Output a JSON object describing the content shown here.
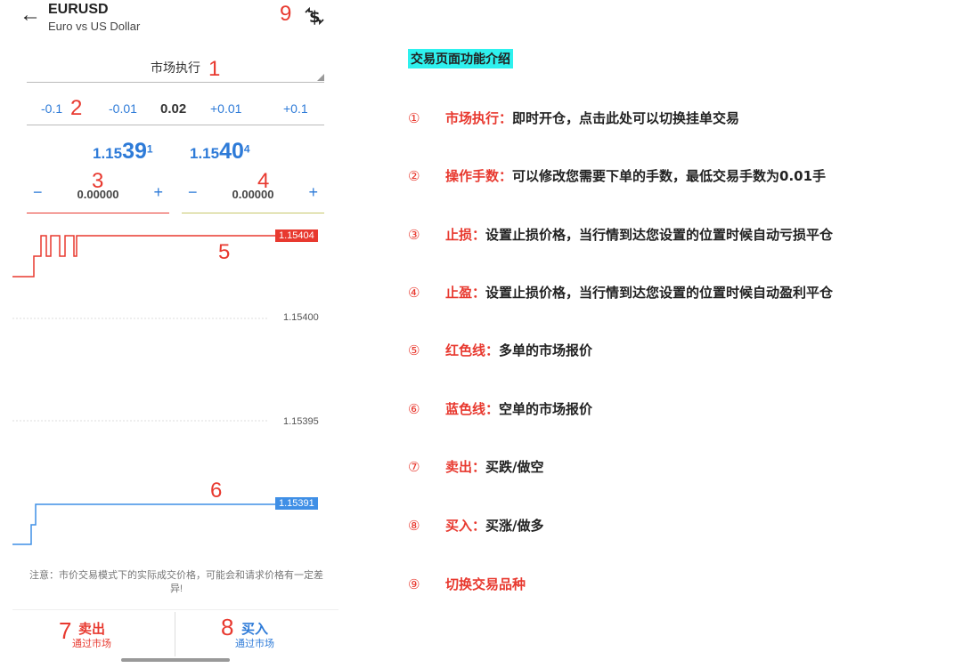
{
  "header": {
    "symbol": "EURUSD",
    "description": "Euro vs US Dollar",
    "switch_marker": "9"
  },
  "mode": {
    "label": "市场执行",
    "marker": "1"
  },
  "volume": {
    "marker": "2",
    "buttons": [
      "-0.1",
      "-0.01",
      "+0.01",
      "+0.1"
    ],
    "value": "0.02"
  },
  "prices": {
    "bid": {
      "prefix": "1.15",
      "big": "39",
      "sup": "1"
    },
    "ask": {
      "prefix": "1.15",
      "big": "40",
      "sup": "4"
    }
  },
  "stop_loss": {
    "marker": "3",
    "minus": "−",
    "plus": "+",
    "value": "0.00000",
    "color": "#e8392f"
  },
  "take_profit": {
    "marker": "4",
    "minus": "−",
    "plus": "+",
    "value": "0.00000",
    "color": "#c7c76b"
  },
  "chart": {
    "ask_tag": "1.15404",
    "bid_tag": "1.15391",
    "axis_labels": [
      "1.15400",
      "1.15395"
    ],
    "ask_marker": "5",
    "bid_marker": "6",
    "ask_color": "#e8392f",
    "bid_color": "#3f8fe6"
  },
  "notice": "注意：市价交易模式下的实际成交价格，可能会和请求价格有一定差异!",
  "sell": {
    "marker": "7",
    "label": "卖出",
    "sub": "通过市场",
    "color": "#e8392f"
  },
  "buy": {
    "marker": "8",
    "label": "买入",
    "sub": "通过市场",
    "color": "#2e7bd8"
  },
  "panel": {
    "title": "交易页面功能介绍",
    "items": [
      {
        "num": "①",
        "key": "市场执行：",
        "desc": "即时开仓，点击此处可以切换挂单交易"
      },
      {
        "num": "②",
        "key": "操作手数：",
        "desc": "可以修改您需要下单的手数，最低交易手数为0.01手"
      },
      {
        "num": "③",
        "key": "止损：",
        "desc": "设置止损价格，当行情到达您设置的位置时候自动亏损平仓"
      },
      {
        "num": "④",
        "key": "止盈：",
        "desc": "设置止损价格，当行情到达您设置的位置时候自动盈利平仓"
      },
      {
        "num": "⑤",
        "key": "红色线：",
        "desc": "多单的市场报价"
      },
      {
        "num": "⑥",
        "key": "蓝色线：",
        "desc": "空单的市场报价"
      },
      {
        "num": "⑦",
        "key": "卖出：",
        "desc": "买跌/做空"
      },
      {
        "num": "⑧",
        "key": "买入：",
        "desc": "买涨/做多"
      },
      {
        "num": "⑨",
        "key": "切换交易品种",
        "desc": ""
      }
    ]
  }
}
